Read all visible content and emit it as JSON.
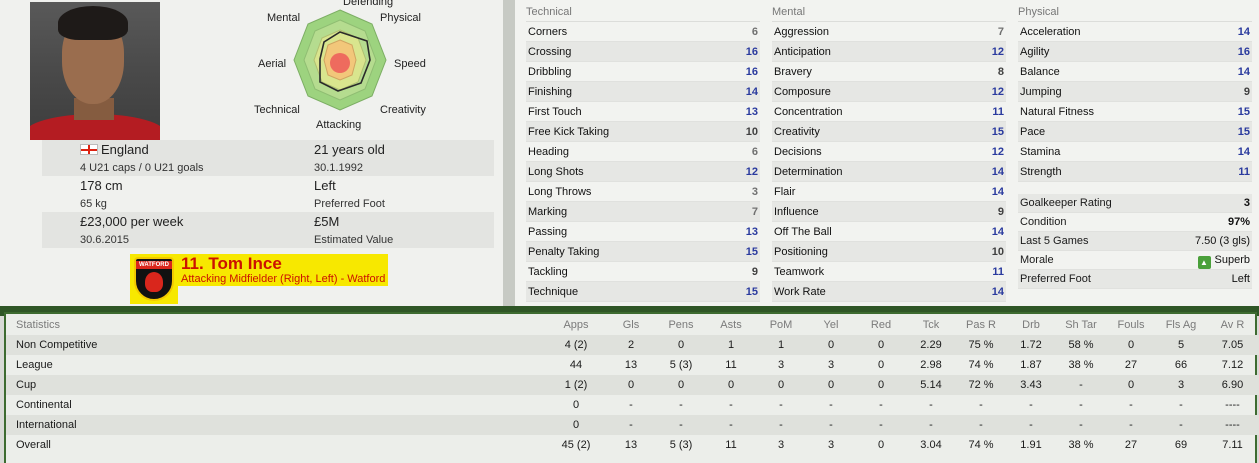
{
  "radar": {
    "labels": {
      "defending": "Defending",
      "physical": "Physical",
      "speed": "Speed",
      "creativity": "Creativity",
      "attacking": "Attacking",
      "technical": "Technical",
      "aerial": "Aerial",
      "mental": "Mental"
    }
  },
  "player_info": {
    "nationality": "England",
    "caps": "4 U21 caps / 0 U21 goals",
    "age": "21 years old",
    "dob": "30.1.1992",
    "height": "178 cm",
    "weight": "65 kg",
    "foot": "Left",
    "foot_label": "Preferred Foot",
    "wage": "£23,000 per week",
    "contract_end": "30.6.2015",
    "value": "£5M",
    "value_label": "Estimated Value",
    "name": "11. Tom Ince",
    "position": "Attacking Midfielder (Right, Left) - Watford",
    "club_badge_text": "WATFORD"
  },
  "technical": {
    "title": "Technical",
    "items": [
      {
        "name": "Corners",
        "value": "6"
      },
      {
        "name": "Crossing",
        "value": "16"
      },
      {
        "name": "Dribbling",
        "value": "16"
      },
      {
        "name": "Finishing",
        "value": "14"
      },
      {
        "name": "First Touch",
        "value": "13"
      },
      {
        "name": "Free Kick Taking",
        "value": "10"
      },
      {
        "name": "Heading",
        "value": "6"
      },
      {
        "name": "Long Shots",
        "value": "12"
      },
      {
        "name": "Long Throws",
        "value": "3"
      },
      {
        "name": "Marking",
        "value": "7"
      },
      {
        "name": "Passing",
        "value": "13"
      },
      {
        "name": "Penalty Taking",
        "value": "15"
      },
      {
        "name": "Tackling",
        "value": "9"
      },
      {
        "name": "Technique",
        "value": "15"
      }
    ]
  },
  "mental": {
    "title": "Mental",
    "items": [
      {
        "name": "Aggression",
        "value": "7"
      },
      {
        "name": "Anticipation",
        "value": "12"
      },
      {
        "name": "Bravery",
        "value": "8"
      },
      {
        "name": "Composure",
        "value": "12"
      },
      {
        "name": "Concentration",
        "value": "11"
      },
      {
        "name": "Creativity",
        "value": "15"
      },
      {
        "name": "Decisions",
        "value": "12"
      },
      {
        "name": "Determination",
        "value": "14"
      },
      {
        "name": "Flair",
        "value": "14"
      },
      {
        "name": "Influence",
        "value": "9"
      },
      {
        "name": "Off The Ball",
        "value": "14"
      },
      {
        "name": "Positioning",
        "value": "10"
      },
      {
        "name": "Teamwork",
        "value": "11"
      },
      {
        "name": "Work Rate",
        "value": "14"
      }
    ]
  },
  "physical": {
    "title": "Physical",
    "items": [
      {
        "name": "Acceleration",
        "value": "14"
      },
      {
        "name": "Agility",
        "value": "16"
      },
      {
        "name": "Balance",
        "value": "14"
      },
      {
        "name": "Jumping",
        "value": "9"
      },
      {
        "name": "Natural Fitness",
        "value": "15"
      },
      {
        "name": "Pace",
        "value": "15"
      },
      {
        "name": "Stamina",
        "value": "14"
      },
      {
        "name": "Strength",
        "value": "11"
      }
    ],
    "goalkeeper_rating_label": "Goalkeeper Rating",
    "goalkeeper_rating": "3",
    "condition_label": "Condition",
    "condition": "97%",
    "last5_label": "Last 5 Games",
    "last5": "7.50 (3 gls)",
    "morale_label": "Morale",
    "morale": "Superb",
    "pref_foot_label": "Preferred Foot",
    "pref_foot": "Left"
  },
  "stats": {
    "headers": [
      "Statistics",
      "Apps",
      "Gls",
      "Pens",
      "Asts",
      "PoM",
      "Yel",
      "Red",
      "Tck",
      "Pas R",
      "Drb",
      "Sh Tar",
      "Fouls",
      "Fls Ag",
      "Av R"
    ],
    "rows": [
      [
        "Non Competitive",
        "4 (2)",
        "2",
        "0",
        "1",
        "1",
        "0",
        "0",
        "2.29",
        "75 %",
        "1.72",
        "58 %",
        "0",
        "5",
        "7.05"
      ],
      [
        "League",
        "44",
        "13",
        "5 (3)",
        "11",
        "3",
        "3",
        "0",
        "2.98",
        "74 %",
        "1.87",
        "38 %",
        "27",
        "66",
        "7.12"
      ],
      [
        "Cup",
        "1 (2)",
        "0",
        "0",
        "0",
        "0",
        "0",
        "0",
        "5.14",
        "72 %",
        "3.43",
        "-",
        "0",
        "3",
        "6.90"
      ],
      [
        "Continental",
        "0",
        "-",
        "-",
        "-",
        "-",
        "-",
        "-",
        "-",
        "-",
        "-",
        "-",
        "-",
        "-",
        "----"
      ],
      [
        "International",
        "0",
        "-",
        "-",
        "-",
        "-",
        "-",
        "-",
        "-",
        "-",
        "-",
        "-",
        "-",
        "-",
        "----"
      ],
      [
        "Overall",
        "45 (2)",
        "13",
        "5 (3)",
        "11",
        "3",
        "3",
        "0",
        "3.04",
        "74 %",
        "1.91",
        "38 %",
        "27",
        "69",
        "7.11"
      ]
    ]
  }
}
